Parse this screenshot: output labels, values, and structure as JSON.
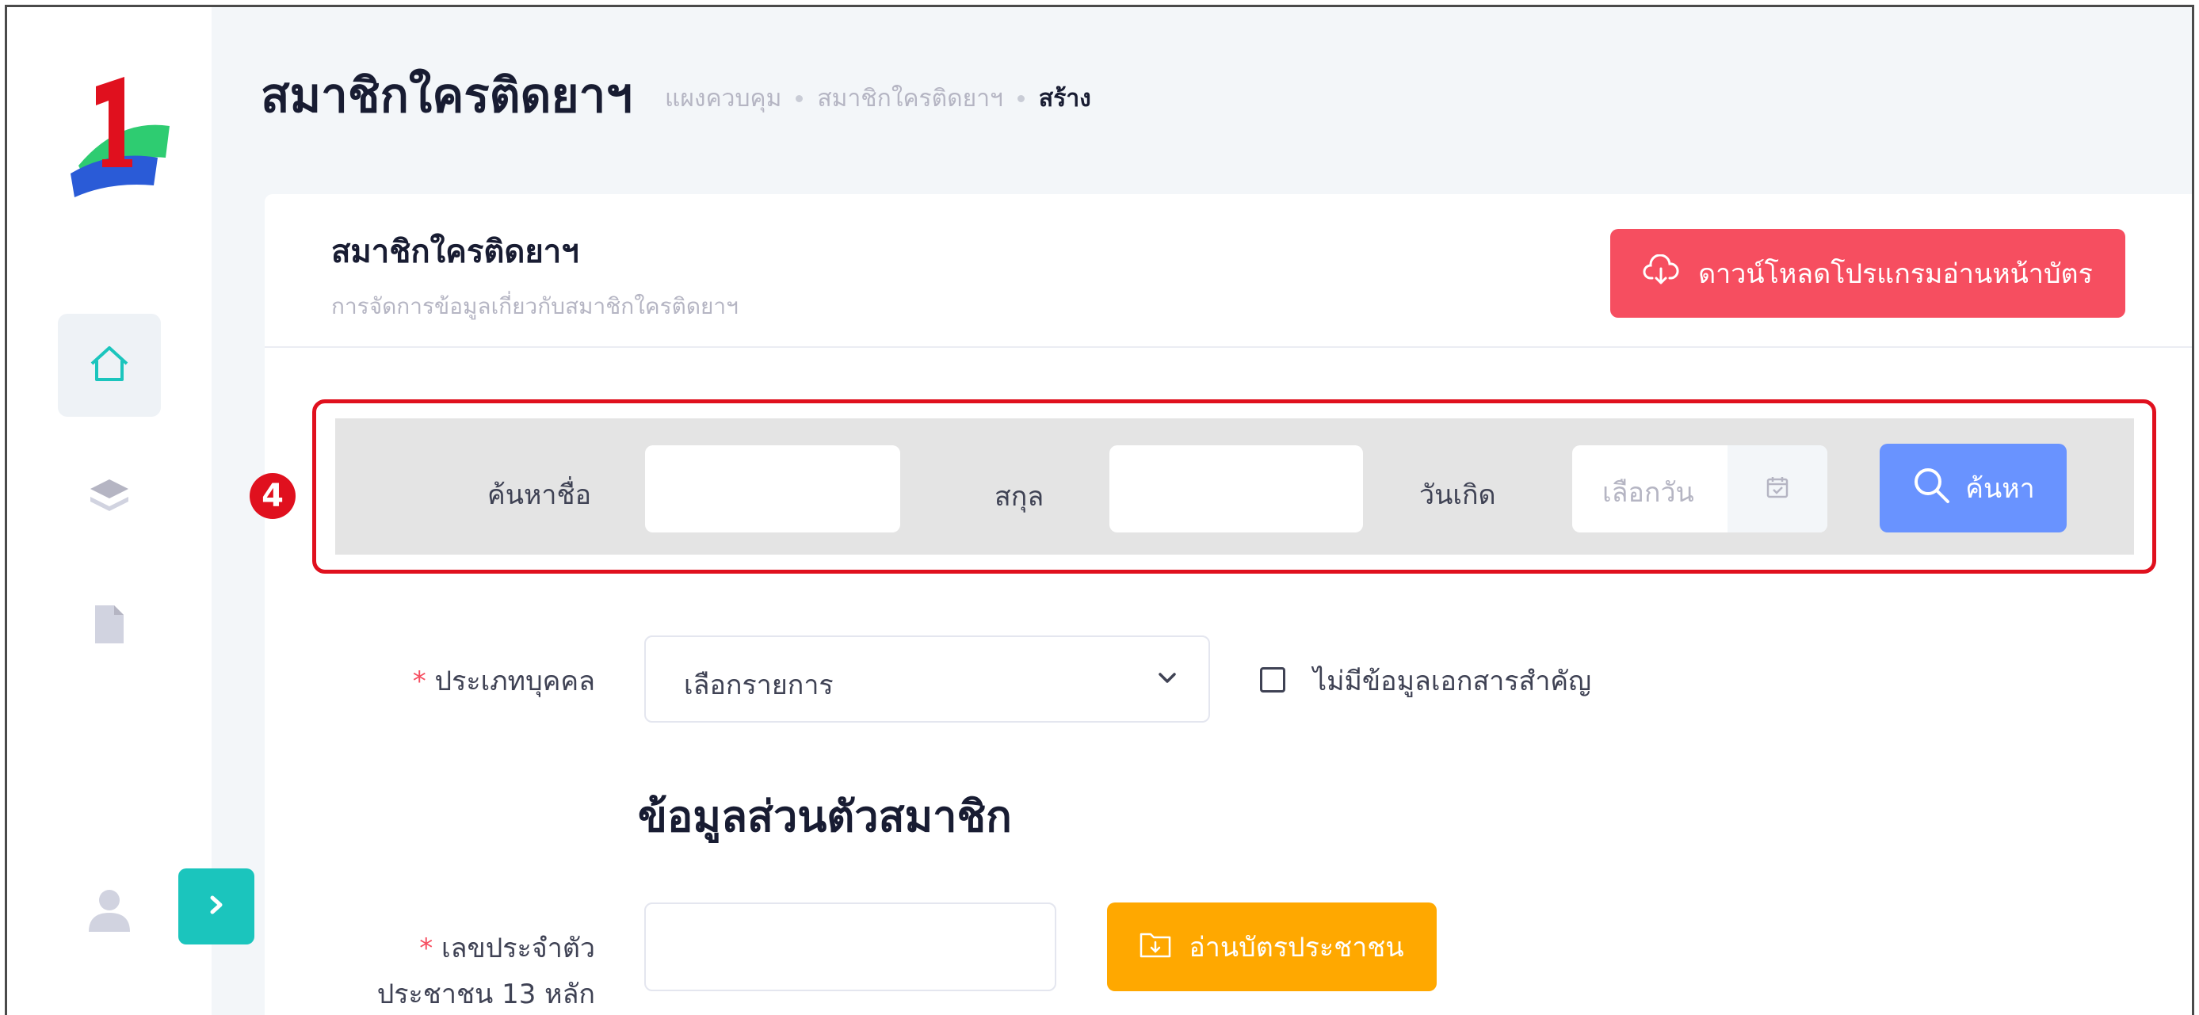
{
  "header": {
    "title": "สมาชิกใครติดยาฯ",
    "breadcrumb": [
      "แผงควบคุม",
      "สมาชิกใครติดยาฯ",
      "สร้าง"
    ]
  },
  "card": {
    "title": "สมาชิกใครติดยาฯ",
    "subtitle": "การจัดการข้อมูลเกี่ยวกับสมาชิกใครติดยาฯ",
    "download_button": "ดาวน์โหลดโปรแกรมอ่านหน้าบัตร"
  },
  "search": {
    "marker": "4",
    "name_label": "ค้นหาชื่อ",
    "name_value": "",
    "surname_label": "สกุล",
    "surname_value": "",
    "birthdate_label": "วันเกิด",
    "birthdate_placeholder": "เลือกวัน",
    "search_button": "ค้นหา"
  },
  "form": {
    "required_mark": "*",
    "person_type_label": "ประเภทบุคคล",
    "person_type_selected": "เลือกรายการ",
    "no_document_label": "ไม่มีข้อมูลเอกสารสำคัญ",
    "section_title": "ข้อมูลส่วนตัวสมาชิก",
    "id_label_line1": "เลขประจำตัว",
    "id_label_line2": "ประชาชน 13 หลัก",
    "id_value": "",
    "read_card_button": "อ่านบัตรประชาชน"
  },
  "colors": {
    "danger": "#f64e60",
    "primary": "#6993ff",
    "warning": "#ffa800",
    "teal": "#1bc5bd",
    "highlight": "#e0101e"
  },
  "icons": [
    "logo",
    "home-icon",
    "layers-icon",
    "file-icon",
    "user-icon",
    "chevron-right-icon",
    "cloud-download-icon",
    "calendar-icon",
    "search-icon",
    "chevron-down-icon",
    "id-card-icon"
  ]
}
